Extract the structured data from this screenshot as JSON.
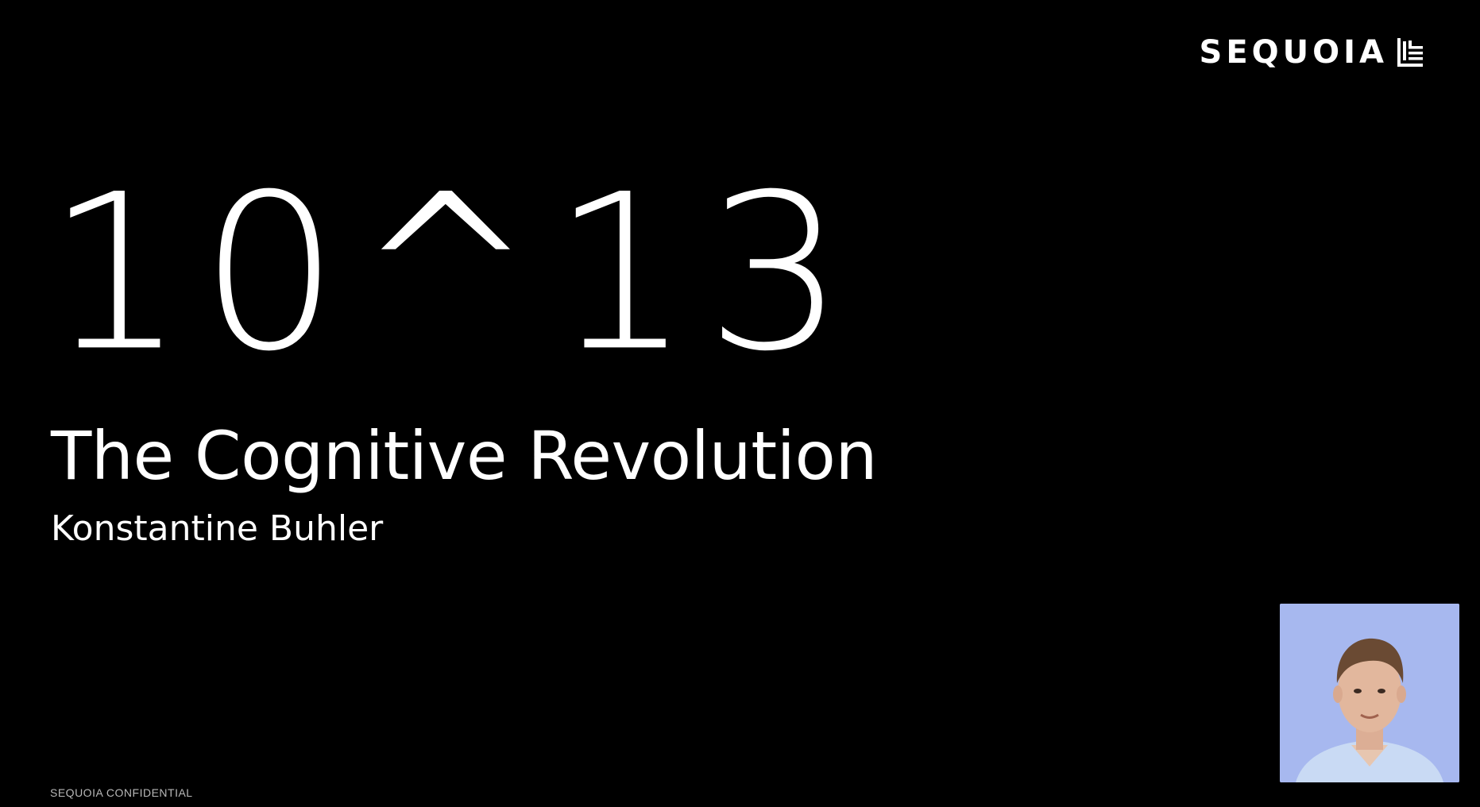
{
  "brand": {
    "wordmark": "SEQUOIA",
    "logo_icon": "sequoia-logo-mark"
  },
  "slide": {
    "hero_number": "10^13",
    "subtitle": "The Cognitive Revolution",
    "presenter": "Konstantine Buhler",
    "footer": "SEQUOIA CONFIDENTIAL"
  },
  "webcam": {
    "icon": "presenter-webcam-feed",
    "background_color": "#a4b6ee"
  },
  "colors": {
    "background": "#000000",
    "text": "#ffffff",
    "footer_text": "#b8b8b8"
  }
}
